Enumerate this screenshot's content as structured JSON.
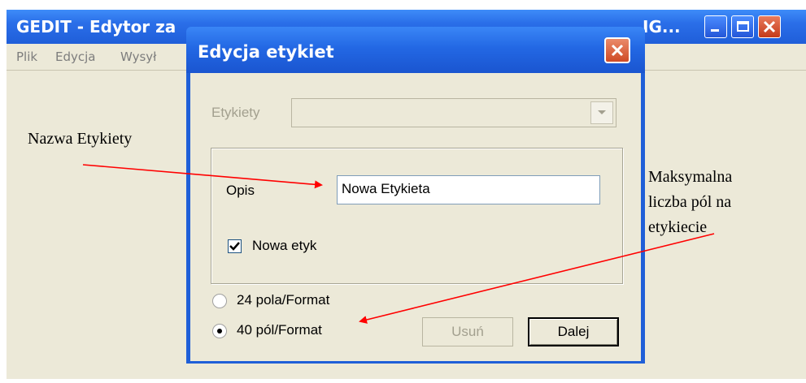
{
  "main_window": {
    "title": "GEDIT - Edytor za",
    "title_tail": "IG...",
    "menu": [
      "Plik",
      "Edycja",
      "Wysył"
    ]
  },
  "dialog": {
    "title": "Edycja etykiet",
    "etykiety_label": "Etykiety",
    "opis_label": "Opis",
    "opis_value": "Nowa Etykieta",
    "checkbox_label": "Nowa etyk",
    "checkbox_checked": true,
    "radio_options": [
      {
        "label": "24 pola/Format",
        "selected": false
      },
      {
        "label": "40 pól/Format",
        "selected": true
      }
    ],
    "buttons": {
      "delete": "Usuń",
      "next": "Dalej"
    }
  },
  "annotations": {
    "left": "Nazwa Etykiety",
    "right_lines": [
      "Maksymalna",
      "liczba pól na",
      "etykiecie"
    ],
    "arrow_color": "#ff0000"
  }
}
